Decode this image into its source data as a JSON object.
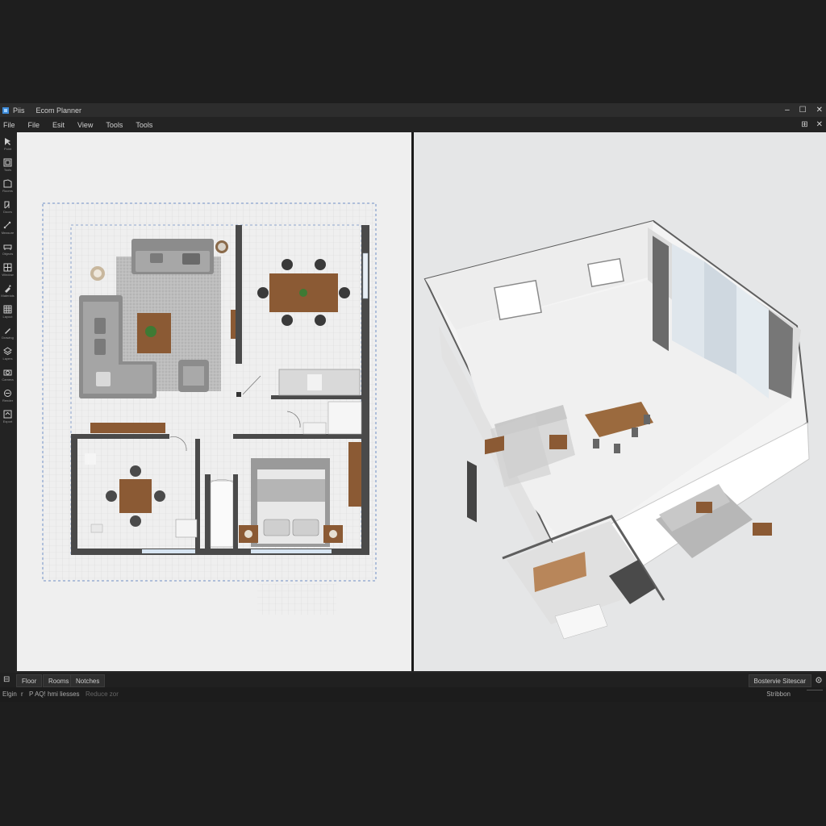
{
  "app": {
    "logo_label": "Piis",
    "title": "Ecom Planner"
  },
  "window_controls": {
    "minimize": "–",
    "maximize": "☐",
    "close": "✕"
  },
  "menu": [
    "File",
    "Esit",
    "View",
    "Tools",
    "Tools"
  ],
  "menu_right": {
    "layout": "⊞",
    "close": "✕"
  },
  "tools": [
    {
      "icon": "select-icon",
      "label": "Point"
    },
    {
      "icon": "wall-icon",
      "label": "Tools"
    },
    {
      "icon": "room-icon",
      "label": "Rooms"
    },
    {
      "icon": "door-icon",
      "label": "Doors"
    },
    {
      "icon": "measure-icon",
      "label": "Measure"
    },
    {
      "icon": "furniture-icon",
      "label": "Objects"
    },
    {
      "icon": "window-icon",
      "label": "Window"
    },
    {
      "icon": "paint-icon",
      "label": "Materials"
    },
    {
      "icon": "grid-icon",
      "label": "Layout"
    },
    {
      "icon": "pen-icon",
      "label": "Drawing"
    },
    {
      "icon": "layer-icon",
      "label": "Layers"
    },
    {
      "icon": "camera-icon",
      "label": "Camera"
    },
    {
      "icon": "render-icon",
      "label": "Render"
    },
    {
      "icon": "export-icon",
      "label": "Export"
    }
  ],
  "bottom_tabs": {
    "toggle_icon": "⊟",
    "tab1": "Floor",
    "tab2": "Rooms",
    "tab3": "Notches"
  },
  "bottom_right": {
    "label": "Bostervie  Sitescar",
    "icon": "settings-icon"
  },
  "status": {
    "left1": "Elgin",
    "left2": "r",
    "left3": "P AQ! hmi liesses",
    "left4": "Reduce zor",
    "right": "Stribbon"
  }
}
